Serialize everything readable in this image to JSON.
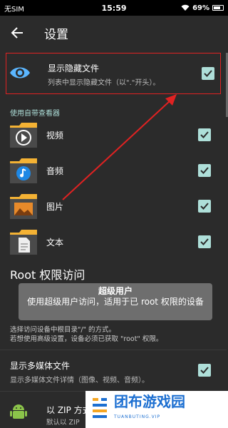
{
  "status_bar": {
    "carrier": "无SIM",
    "time": "15:59",
    "battery": "69%"
  },
  "app_bar": {
    "title": "设置"
  },
  "show_hidden": {
    "title": "显示隐藏文件",
    "subtitle": "列表中显示隐藏文件（以\".\"开头）。",
    "checked": true
  },
  "viewer_section": {
    "label": "使用自带查看器"
  },
  "viewers": [
    {
      "label": "视频",
      "icon": "video-icon",
      "checked": true
    },
    {
      "label": "音频",
      "icon": "music-icon",
      "checked": true
    },
    {
      "label": "图片",
      "icon": "image-icon",
      "checked": true
    },
    {
      "label": "文本",
      "icon": "document-icon",
      "checked": true
    }
  ],
  "root_section": {
    "title": "Root 权限访问",
    "tooltip_title": "超级用户",
    "tooltip_body": "使用超级用户访问，适用于已 root 权限的设备",
    "desc_line1": "选择访问设备中根目录\"/\" 的方式。",
    "desc_line2": "若想使用高级设置，设备必须已获取 \"root\" 权限。"
  },
  "media_files": {
    "title": "显示多媒体文件",
    "subtitle": "显示多媒体文件详情（图像、视频、音频）。",
    "checked": true
  },
  "zip": {
    "title": "以 ZIP 方式",
    "subtitle": "默认以 ZIP"
  },
  "watermark": {
    "text": "团布游戏园",
    "sub": "TUANBUTING.VIP"
  },
  "colors": {
    "accent": "#aedfd9",
    "highlight": "#e02222",
    "background": "#2b2b2b"
  }
}
